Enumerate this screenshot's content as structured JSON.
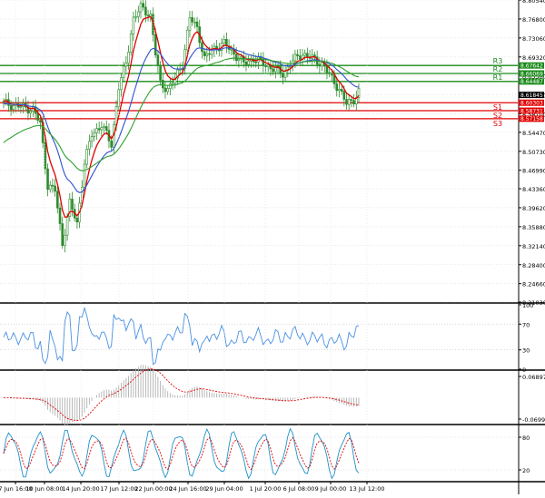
{
  "chart_data": {
    "type": "candlestick",
    "colors": {
      "candle": "#2e8b2e",
      "ma_fast": "#e00000",
      "ma_mid": "#3050d0",
      "ma_slow": "#2ca02c",
      "support_line": "#e00000",
      "resistance_line": "#1a8a1a",
      "rsi": "#4a90e2",
      "macd_hist": "#b0b0b0",
      "macd_signal": "#e00000",
      "stoch_k": "#1e90c8",
      "stoch_d": "#e00000"
    },
    "price_axis": {
      "ylim": [
        8.2103,
        8.8054
      ],
      "ticks": [
        "8.80540",
        "8.76800",
        "8.73060",
        "8.69320",
        "8.65580",
        "8.61840",
        "8.58100",
        "8.54470",
        "8.50730",
        "8.46990",
        "8.43360",
        "8.39620",
        "8.35880",
        "8.32140",
        "8.28400",
        "8.24660",
        "8.21030"
      ]
    },
    "levels": [
      {
        "name": "R3",
        "value": 8.67642,
        "label": "8.67642",
        "kind": "resistance"
      },
      {
        "name": "R2",
        "value": 8.66069,
        "label": "8.66069",
        "kind": "resistance"
      },
      {
        "name": "R1",
        "value": 8.64487,
        "label": "8.64487",
        "kind": "resistance"
      },
      {
        "name": "",
        "value": 8.61845,
        "label": "8.61845",
        "kind": "current"
      },
      {
        "name": "S1",
        "value": 8.60303,
        "label": "8.60303",
        "kind": "support"
      },
      {
        "name": "S2",
        "value": 8.58731,
        "label": "8.58731",
        "kind": "support"
      },
      {
        "name": "S3",
        "value": 8.57158,
        "label": "8.57158",
        "kind": "support"
      }
    ],
    "x_labels": [
      "7 Jun 16:00",
      "10 Jun 08:00",
      "14 Jun 20:00",
      "17 Jun 12:00",
      "22 Jun 00:00",
      "24 Jun 16:00",
      "29 Jun 04:00",
      "1 Jul 20:00",
      "6 Jul 08:00",
      "9 Jul 00:00",
      "13 Jul 12:00"
    ],
    "price_anchors": [
      [
        0,
        8.602
      ],
      [
        4,
        8.598
      ],
      [
        8,
        8.594
      ],
      [
        12,
        8.59
      ],
      [
        15,
        8.56
      ],
      [
        18,
        8.44
      ],
      [
        21,
        8.43
      ],
      [
        24,
        8.325
      ],
      [
        27,
        8.405
      ],
      [
        30,
        8.365
      ],
      [
        33,
        8.485
      ],
      [
        36,
        8.54
      ],
      [
        40,
        8.56
      ],
      [
        44,
        8.52
      ],
      [
        47,
        8.635
      ],
      [
        50,
        8.68
      ],
      [
        53,
        8.77
      ],
      [
        56,
        8.79
      ],
      [
        60,
        8.775
      ],
      [
        62,
        8.7
      ],
      [
        64,
        8.64
      ],
      [
        67,
        8.63
      ],
      [
        70,
        8.65
      ],
      [
        73,
        8.68
      ],
      [
        76,
        8.77
      ],
      [
        79,
        8.75
      ],
      [
        82,
        8.69
      ],
      [
        86,
        8.71
      ],
      [
        90,
        8.72
      ],
      [
        94,
        8.7
      ],
      [
        98,
        8.68
      ],
      [
        102,
        8.69
      ],
      [
        106,
        8.68
      ],
      [
        110,
        8.67
      ],
      [
        114,
        8.66
      ],
      [
        118,
        8.685
      ],
      [
        122,
        8.7
      ],
      [
        126,
        8.69
      ],
      [
        130,
        8.68
      ],
      [
        134,
        8.65
      ],
      [
        137,
        8.63
      ],
      [
        140,
        8.6
      ],
      [
        143,
        8.61
      ],
      [
        145,
        8.625
      ]
    ],
    "rsi": {
      "ylim": [
        0,
        100
      ],
      "ticks": [
        "100",
        "70",
        "30",
        "0"
      ]
    },
    "macd": {
      "ticks": [
        "0.068971",
        "-0.069998"
      ]
    },
    "stochastic": {
      "ylim": [
        0,
        100
      ],
      "ticks": [
        "80",
        "20"
      ]
    }
  }
}
